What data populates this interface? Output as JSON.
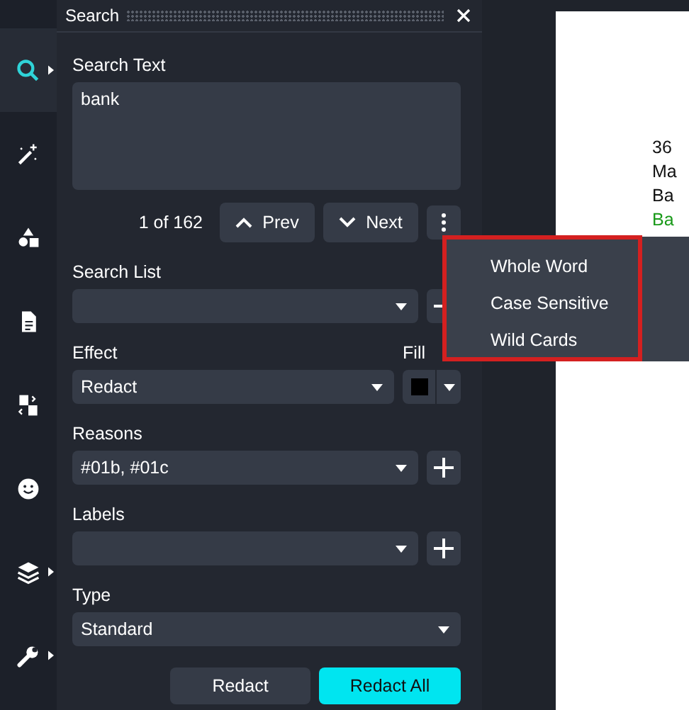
{
  "sidebar": {
    "items": [
      {
        "kind": "search",
        "selected": true,
        "submenu": true
      },
      {
        "kind": "wand",
        "selected": false,
        "submenu": false
      },
      {
        "kind": "shapes",
        "selected": false,
        "submenu": false
      },
      {
        "kind": "document",
        "selected": false,
        "submenu": false
      },
      {
        "kind": "swap",
        "selected": false,
        "submenu": false
      },
      {
        "kind": "smiley",
        "selected": false,
        "submenu": false
      },
      {
        "kind": "layers",
        "selected": false,
        "submenu": true
      },
      {
        "kind": "wrench",
        "selected": false,
        "submenu": true
      }
    ]
  },
  "panel": {
    "title": "Search",
    "search_text": {
      "label": "Search Text",
      "value": "bank"
    },
    "results": "1 of 162",
    "prev": "Prev",
    "next": "Next",
    "search_list": {
      "label": "Search List"
    },
    "effect": {
      "label": "Effect",
      "value": "Redact",
      "fill_label": "Fill"
    },
    "reasons": {
      "label": "Reasons",
      "value": "#01b, #01c"
    },
    "labels": {
      "label": "Labels"
    },
    "type": {
      "label": "Type",
      "value": "Standard"
    },
    "buttons": [
      {
        "label": "Redact",
        "primary": false
      },
      {
        "label": "Redact All",
        "primary": true
      }
    ]
  },
  "options_menu": {
    "items": [
      "Whole Word",
      "Case Sensitive",
      "Wild Cards"
    ]
  },
  "document": {
    "lines": [
      {
        "text": "36",
        "highlighted": false
      },
      {
        "text": "Ma",
        "highlighted": false
      },
      {
        "text": "Ba",
        "highlighted": false
      },
      {
        "text": "Ba",
        "highlighted": true
      }
    ]
  }
}
